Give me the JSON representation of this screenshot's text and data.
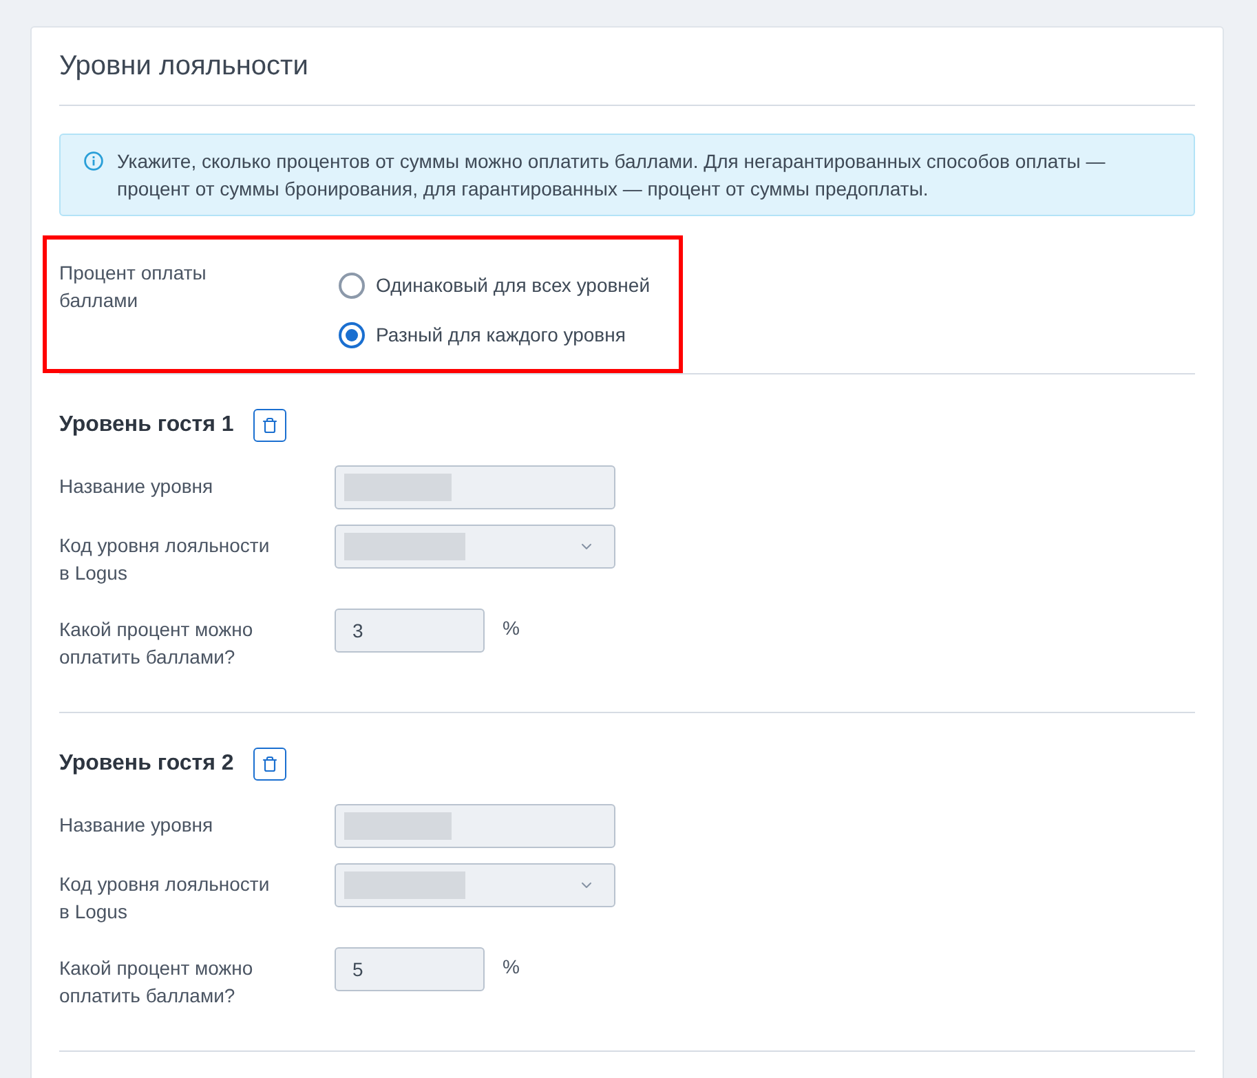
{
  "card": {
    "title": "Уровни лояльности"
  },
  "info": {
    "text": "Укажите, сколько процентов от суммы можно оплатить баллами. Для негарантированных способов оплаты — процент от суммы бронирования, для гарантированных — процент от суммы предоплаты."
  },
  "payment_percent": {
    "label": "Процент оплаты баллами",
    "highlighted": true,
    "options": [
      {
        "label": "Одинаковый для всех уровней",
        "selected": false
      },
      {
        "label": "Разный для каждого уровня",
        "selected": true
      }
    ]
  },
  "levels": [
    {
      "title": "Уровень гостя 1",
      "fields": [
        {
          "kind": "text",
          "label": "Название уровня",
          "value_hidden": true
        },
        {
          "kind": "select",
          "label": "Код уровня лояльности в Logus",
          "value_hidden": true
        },
        {
          "kind": "number",
          "label": "Какой процент можно оплатить баллами?",
          "value": "3",
          "unit": "%"
        }
      ]
    },
    {
      "title": "Уровень гостя 2",
      "fields": [
        {
          "kind": "text",
          "label": "Название уровня",
          "value_hidden": true
        },
        {
          "kind": "select",
          "label": "Код уровня лояльности в Logus",
          "value_hidden": true
        },
        {
          "kind": "number",
          "label": "Какой процент можно оплатить баллами?",
          "value": "5",
          "unit": "%"
        }
      ]
    }
  ]
}
